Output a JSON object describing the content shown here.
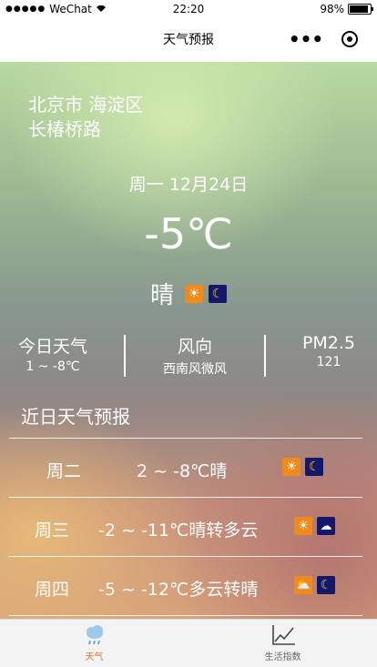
{
  "status_bar": {
    "signal": "●●●●●",
    "carrier": "WeChat",
    "wifi": "wifi-icon",
    "time": "22:20",
    "battery_percent": "98%",
    "battery_level": 0.98
  },
  "navbar": {
    "title": "天气预报",
    "more": "•••"
  },
  "location": {
    "line1": "北京市 海淀区",
    "line2": "长椿桥路"
  },
  "today": {
    "date": "周一 12月24日",
    "temperature": "-5℃",
    "condition": "晴",
    "icons": [
      "sun-icon",
      "moon-icon"
    ]
  },
  "stats": [
    {
      "label": "今日天气",
      "value": "1 ~ -8℃"
    },
    {
      "label": "风向",
      "value": "西南风微风"
    },
    {
      "label": "PM2.5",
      "value": "121"
    }
  ],
  "forecast": {
    "title": "近日天气预报",
    "days": [
      {
        "day": "周二",
        "detail": "2 ~ -8℃晴",
        "icons": [
          "sun-icon",
          "moon-icon"
        ]
      },
      {
        "day": "周三",
        "detail": "-2 ~ -11℃晴转多云",
        "icons": [
          "sun-icon",
          "night-cloudy-icon"
        ]
      },
      {
        "day": "周四",
        "detail": "-5 ~ -12℃多云转晴",
        "icons": [
          "partly-cloudy-icon",
          "moon-icon"
        ]
      }
    ]
  },
  "tabbar": {
    "tabs": [
      {
        "label": "天气",
        "icon": "weather-rain-icon",
        "active": true
      },
      {
        "label": "生活指数",
        "icon": "chart-line-icon",
        "active": false
      }
    ],
    "active_color": "#e0712b",
    "inactive_color": "#666666"
  }
}
